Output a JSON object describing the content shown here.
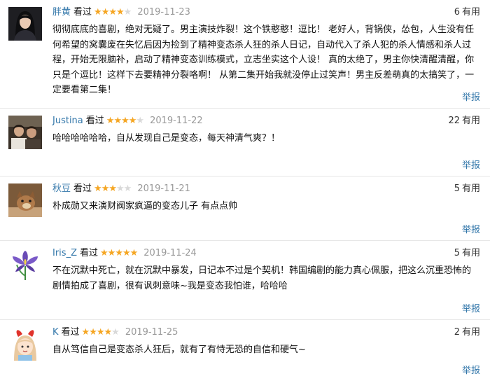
{
  "reviews": [
    {
      "user": "胖黄",
      "watched": "看过",
      "stars": 4,
      "date": "2019-11-23",
      "votes": "6",
      "votes_label": "有用",
      "content": "彻彻底底的喜剧，绝对无疑了。男主演技炸裂！这个铁憨憨！逗比！ 老好人，背锅侠，怂包，人生没有任何希望的窝囊废在失忆后因为捡到了精神变态杀人狂的杀人日记，自动代入了杀人犯的杀人情感和杀人过程，开始无限脑补，启动了精神变态训练模式，立志坐实这个人设！ 真的太绝了，男主你快清醒清醒，你只是个逗比！这样下去要精神分裂咯啊！ 从第二集开始我就没停止过笑声！男主反差萌真的太搞笑了，一定要看第二集！",
      "report": "举报",
      "avatar": "woman-long-hair-avatar"
    },
    {
      "user": "Justina",
      "watched": "看过",
      "stars": 4,
      "date": "2019-11-22",
      "votes": "22",
      "votes_label": "有用",
      "content": "哈哈哈哈哈哈，自从发现自己是变态，每天神清气爽？！",
      "report": "举报",
      "avatar": "movie-still-avatar"
    },
    {
      "user": "秋豆",
      "watched": "看过",
      "stars": 3,
      "date": "2019-11-21",
      "votes": "5",
      "votes_label": "有用",
      "content": "朴成勋又来演财阀家疯逼的变态儿子 有点点帅",
      "report": "举报",
      "avatar": "toy-animal-avatar"
    },
    {
      "user": "Iris_Z",
      "watched": "看过",
      "stars": 5,
      "date": "2019-11-24",
      "votes": "5",
      "votes_label": "有用",
      "content": "不在沉默中死亡，就在沉默中暴发，日记本不过是个契机！韩国编剧的能力真心佩服，把这么沉重恐怖的剧情拍成了喜剧，很有讽刺意味~我是变态我怕谁，哈哈哈",
      "report": "举报",
      "avatar": "iris-flower-avatar"
    },
    {
      "user": "K",
      "watched": "看过",
      "stars": 4,
      "date": "2019-11-25",
      "votes": "2",
      "votes_label": "有用",
      "content": "自从笃信自己是变态杀人狂后，就有了有恃无恐的自信和硬气~",
      "report": "举报",
      "avatar": "cartoon-bow-girl-avatar"
    }
  ]
}
